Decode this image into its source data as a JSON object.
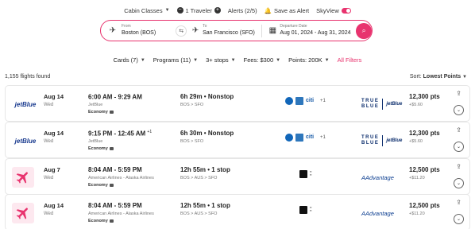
{
  "topbar": {
    "cabin_classes": "Cabin Classes",
    "travelers": "1 Traveler",
    "alerts": "Alerts (2/5)",
    "save_alert": "Save as Alert",
    "skyview": "SkyView"
  },
  "search": {
    "from_label": "From",
    "from_value": "Boston (BOS)",
    "to_label": "To",
    "to_value": "San Francisco (SFO)",
    "date_label": "Departure Date",
    "date_value": "Aug 01, 2024 - Aug 31, 2024"
  },
  "filters": {
    "cards": "Cards (7)",
    "programs": "Programs (11)",
    "stops": "3+ stops",
    "fees": "Fees: $300",
    "points": "Points: 200K",
    "all_filters": "All Filters"
  },
  "results": {
    "count": "1,155 flights found",
    "sort_label": "Sort:",
    "sort_value": "Lowest Points"
  },
  "flights": [
    {
      "airline": "jetBlue",
      "date": "Aug 14",
      "dow": "Wed",
      "times": "6:00 AM - 9:29 AM",
      "day_offset": "",
      "carrier": "JetBlue",
      "cabin": "Economy",
      "duration": "6h 29m • Nonstop",
      "route": "BOS  >  SFO",
      "card_more": "+1",
      "program_top": "TRUE",
      "program_bottom": "BLUE",
      "program_side": "jetBlue",
      "points": "12,300 pts",
      "tax": "+$5.60"
    },
    {
      "airline": "jetBlue",
      "date": "Aug 14",
      "dow": "Wed",
      "times": "9:15 PM - 12:45 AM",
      "day_offset": "+1",
      "carrier": "JetBlue",
      "cabin": "Economy",
      "duration": "6h 30m • Nonstop",
      "route": "BOS  >  SFO",
      "card_more": "+1",
      "program_top": "TRUE",
      "program_bottom": "BLUE",
      "program_side": "jetBlue",
      "points": "12,300 pts",
      "tax": "+$5.60"
    },
    {
      "airline": "",
      "date": "Aug 7",
      "dow": "Wed",
      "times": "8:04 AM - 5:59 PM",
      "day_offset": "",
      "carrier": "American Airlines - Alaska Airlines",
      "cabin": "Economy",
      "duration": "12h 55m • 1 stop",
      "route": "BOS  >  AUS  >  SFO",
      "card_more": "",
      "program_top": "AAdvantage",
      "program_bottom": "",
      "program_side": "",
      "points": "12,500 pts",
      "tax": "+$11.20"
    },
    {
      "airline": "",
      "date": "Aug 14",
      "dow": "Wed",
      "times": "8:04 AM - 5:59 PM",
      "day_offset": "",
      "carrier": "American Airlines - Alaska Airlines",
      "cabin": "Economy",
      "duration": "12h 55m • 1 stop",
      "route": "BOS  >  AUS  >  SFO",
      "card_more": "",
      "program_top": "AAdvantage",
      "program_bottom": "",
      "program_side": "",
      "points": "12,500 pts",
      "tax": "+$11.20"
    }
  ],
  "colors": {
    "accent": "#e8336e",
    "jetblue": "#1a3b8f"
  }
}
